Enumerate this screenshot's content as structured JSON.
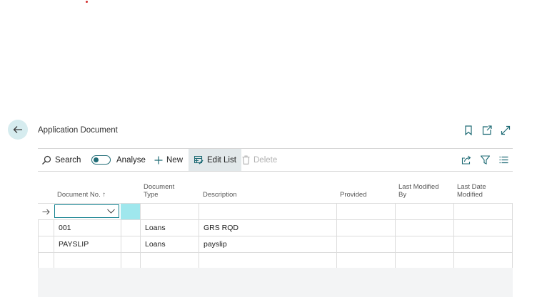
{
  "header": {
    "title": "Application Document"
  },
  "toolbar": {
    "search_label": "Search",
    "analyse_label": "Analyse",
    "new_label": "New",
    "edit_list_label": "Edit List",
    "delete_label": "Delete"
  },
  "columns": [
    {
      "label": "Document No. ↑"
    },
    {
      "label": "Document Type"
    },
    {
      "label": "Description"
    },
    {
      "label": "Provided"
    },
    {
      "label": "Last Modified By"
    },
    {
      "label": "Last Date Modified"
    }
  ],
  "rows": [
    {
      "document_no": "001",
      "document_type": "Loans",
      "description": "GRS RQD",
      "provided": "",
      "last_modified_by": "",
      "last_date_modified": ""
    },
    {
      "document_no": "PAYSLIP",
      "document_type": "Loans",
      "description": "payslip",
      "provided": "",
      "last_modified_by": "",
      "last_date_modified": ""
    }
  ],
  "new_row": {
    "document_no": "",
    "document_type": "",
    "description": ""
  },
  "icons": [
    "back-arrow-icon",
    "bookmark-icon",
    "open-new-window-icon",
    "expand-icon",
    "search-icon",
    "plus-icon",
    "edit-list-icon",
    "trash-icon",
    "share-icon",
    "filter-icon",
    "list-view-icon",
    "right-arrow-icon",
    "chevron-down-icon"
  ],
  "colors": {
    "accent": "#1f6b75",
    "selected_cell": "#9fe7ed",
    "back_button_bg": "#d6ecef",
    "active_action_bg": "#e2e8ea"
  }
}
